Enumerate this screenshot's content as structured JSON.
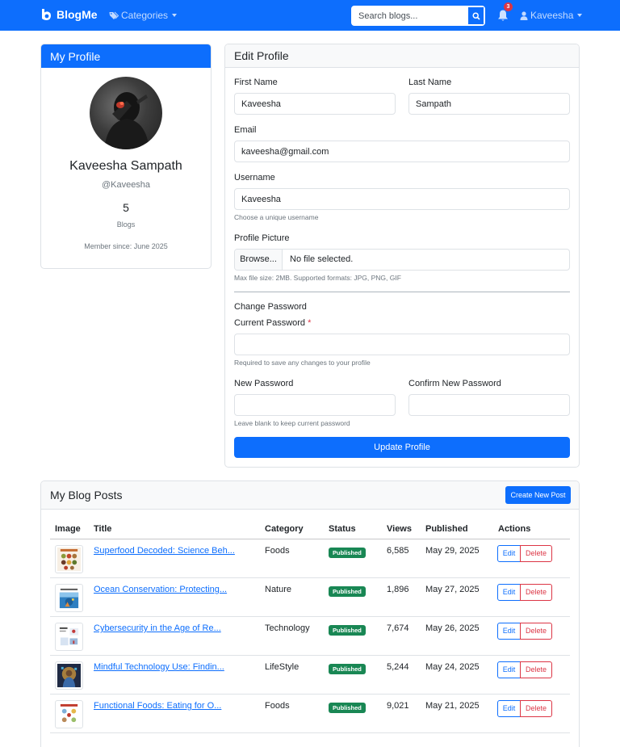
{
  "navbar": {
    "brand": "BlogMe",
    "categories_label": "Categories",
    "search_placeholder": "Search blogs...",
    "notification_count": "3",
    "user_label": "Kaveesha"
  },
  "profile": {
    "header": "My Profile",
    "full_name": "Kaveesha Sampath",
    "username": "@Kaveesha",
    "blog_count": "5",
    "blog_count_label": "Blogs",
    "member_since": "Member since: June 2025"
  },
  "edit_profile": {
    "header": "Edit Profile",
    "first_name_label": "First Name",
    "first_name_value": "Kaveesha",
    "last_name_label": "Last Name",
    "last_name_value": "Sampath",
    "email_label": "Email",
    "email_value": "kaveesha@gmail.com",
    "username_label": "Username",
    "username_value": "Kaveesha",
    "username_hint": "Choose a unique username",
    "picture_label": "Profile Picture",
    "browse_label": "Browse...",
    "no_file_text": "No file selected.",
    "picture_hint": "Max file size: 2MB. Supported formats: JPG, PNG, GIF",
    "change_password_label": "Change Password",
    "current_password_label": "Current Password",
    "required_mark": "*",
    "current_password_hint": "Required to save any changes to your profile",
    "new_password_label": "New Password",
    "confirm_password_label": "Confirm New Password",
    "new_password_hint": "Leave blank to keep current password",
    "update_button": "Update Profile"
  },
  "posts": {
    "header": "My Blog Posts",
    "create_button": "Create New Post",
    "columns": [
      "Image",
      "Title",
      "Category",
      "Status",
      "Views",
      "Published",
      "Actions"
    ],
    "edit_label": "Edit",
    "delete_label": "Delete",
    "rows": [
      {
        "title": "Superfood Decoded: Science Beh...",
        "category": "Foods",
        "status": "Published",
        "views": "6,585",
        "published": "May 29, 2025"
      },
      {
        "title": "Ocean Conservation: Protecting...",
        "category": "Nature",
        "status": "Published",
        "views": "1,896",
        "published": "May 27, 2025"
      },
      {
        "title": "Cybersecurity in the Age of Re...",
        "category": "Technology",
        "status": "Published",
        "views": "7,674",
        "published": "May 26, 2025"
      },
      {
        "title": "Mindful Technology Use: Findin...",
        "category": "LifeStyle",
        "status": "Published",
        "views": "5,244",
        "published": "May 24, 2025"
      },
      {
        "title": "Functional Foods: Eating for O...",
        "category": "Foods",
        "status": "Published",
        "views": "9,021",
        "published": "May 21, 2025"
      }
    ]
  },
  "colors": {
    "primary": "#0d6efd",
    "success": "#198754",
    "danger": "#dc3545"
  }
}
